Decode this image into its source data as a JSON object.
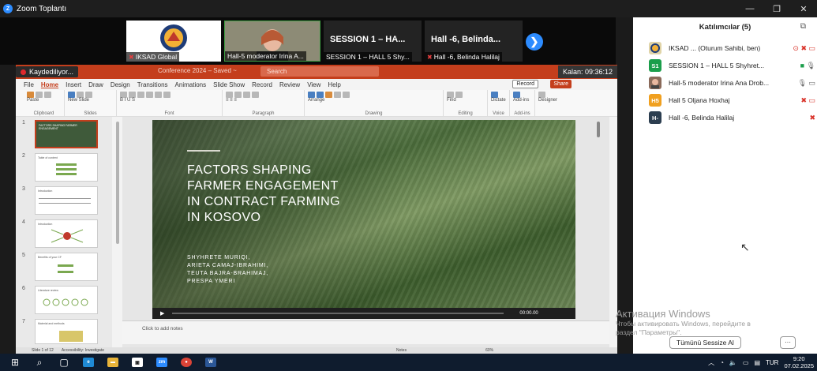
{
  "zoom": {
    "window_title": "Zoom Toplantı",
    "logo": "Z"
  },
  "video_strip": {
    "tiles": [
      {
        "label": "IKSAD Global",
        "muted": true
      },
      {
        "label": "Hall-5 moderator Irina A...",
        "muted": false
      },
      {
        "big_name": "SESSION 1 – HA...",
        "label": "SESSION 1 – HALL 5 Shy...",
        "muted": false
      },
      {
        "big_name": "Hall -6, Belinda...",
        "label": "Hall -6, Belinda Halilaj",
        "muted": true
      }
    ],
    "next_icon": "❯"
  },
  "recording": {
    "label": "Kaydediliyor..."
  },
  "timer": {
    "label": "Kalan: 09:36:12"
  },
  "powerpoint": {
    "filename": "Conference 2024 – Saved ~",
    "search_placeholder": "Search",
    "menu": [
      "File",
      "Home",
      "Insert",
      "Draw",
      "Design",
      "Transitions",
      "Animations",
      "Slide Show",
      "Record",
      "Review",
      "View",
      "Help"
    ],
    "active_menu": "Home",
    "record_label": "Record",
    "share_label": "Share",
    "ribbon_groups": [
      {
        "name": "Clipboard",
        "text": "Paste"
      },
      {
        "name": "Slides",
        "text": "New Slide"
      },
      {
        "name": "Font",
        "text": "B I U S"
      },
      {
        "name": "Paragraph",
        "text": "≡ ≡ ≡"
      },
      {
        "name": "Drawing",
        "text": "Arrange"
      },
      {
        "name": "Editing",
        "text": "Find"
      },
      {
        "name": "Voice",
        "text": "Dictate"
      },
      {
        "name": "Add-ins",
        "text": "Add-ins"
      },
      {
        "name": "Designer",
        "text": "Designer"
      }
    ],
    "slides": [
      {
        "num": "1",
        "title": "FACTORS SHAPING FARMER ENGAGEMENT"
      },
      {
        "num": "2",
        "title": "Table of content"
      },
      {
        "num": "3",
        "title": "Introduction"
      },
      {
        "num": "4",
        "title": "Introduction"
      },
      {
        "num": "5",
        "title": "Benefits of your CF"
      },
      {
        "num": "6",
        "title": "Literature review"
      },
      {
        "num": "7",
        "title": "Material and methods"
      }
    ],
    "slide": {
      "title_lines": [
        "FACTORS SHAPING",
        "FARMER ENGAGEMENT",
        "IN CONTRACT FARMING",
        "IN KOSOVO"
      ],
      "authors": [
        "SHYHRETE MURIQI,",
        "ARIETA CAMAJ-IBRAHIMI,",
        "TEUTA BAJRA-BRAHIMAJ,",
        "PRESPA YMERI"
      ]
    },
    "video_time": "00:00.00",
    "notes_placeholder": "Click to add notes",
    "status": {
      "slide_counter": "Slide 1 of 12",
      "accessibility": "Accessibility: Investigate",
      "notes_label": "Notes",
      "zoom": "60%"
    }
  },
  "participants": {
    "header": "Katılımcılar (5)",
    "popout_icon": "⧉",
    "list": [
      {
        "initials": "",
        "name": "IKSAD ... (Oturum Sahibi, ben)",
        "color": "#e0d4a8",
        "icons": "⊙ 🎤̸"
      },
      {
        "initials": "S1",
        "name": "SESSION 1 – HALL 5 Shyhret...",
        "color": "#1b9e4b",
        "icons": "▣ 🎙"
      },
      {
        "initials": "",
        "name": "Hall-5 moderator Irina Ana Drob...",
        "color": "#8a6a5a",
        "icons": "🎙 ▭"
      },
      {
        "initials": "H5",
        "name": "Hall 5 Oljana Hoxhaj",
        "color": "#f0a020",
        "icons": "🎤̸"
      },
      {
        "initials": "H-",
        "name": "Hall -6, Belinda Halilaj",
        "color": "#2c3e50",
        "icons": "🎤̸"
      }
    ],
    "mute_all": "Tümünü Sessize Al",
    "more": "···"
  },
  "windows_activation": {
    "title": "Активация Windows",
    "line1": "Чтобы активировать Windows, перейдите в",
    "line2": "раздел \"Параметры\"."
  },
  "taskbar": {
    "lang": "TUR",
    "time": "9:20",
    "date": "07.02.2025",
    "apps": [
      {
        "name": "windows-start",
        "glyph": "⊞"
      },
      {
        "name": "search",
        "glyph": "⌕"
      },
      {
        "name": "task-view",
        "glyph": "▢"
      },
      {
        "name": "edge",
        "glyph": "e"
      },
      {
        "name": "file-explorer",
        "glyph": "▬"
      },
      {
        "name": "store",
        "glyph": "▣"
      },
      {
        "name": "zoom",
        "glyph": "zm"
      },
      {
        "name": "chrome",
        "glyph": "●"
      },
      {
        "name": "word",
        "glyph": "W"
      }
    ]
  },
  "colors": {
    "powerpoint_accent": "#c43e1c",
    "zoom_blue": "#2d8cff",
    "muted_red": "#d9342b",
    "slide_green": "#59714e"
  }
}
